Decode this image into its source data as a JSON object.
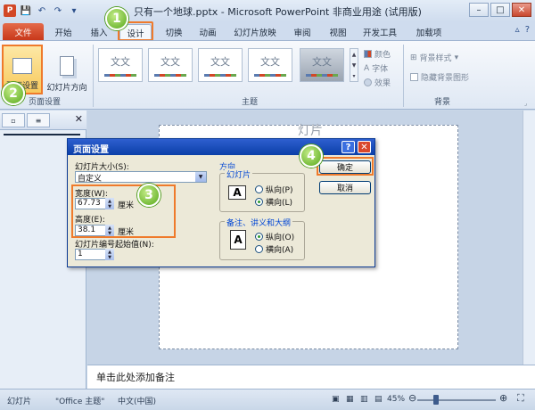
{
  "window": {
    "title": "只有一个地球.pptx - Microsoft PowerPoint 非商业用途 (试用版)",
    "ppt_logo": "P",
    "buttons": {
      "minimize": "–",
      "maximize": "□",
      "close": "✕"
    }
  },
  "tabs": {
    "file": "文件",
    "items": [
      "开始",
      "插入",
      "设计",
      "切换",
      "动画",
      "幻灯片放映",
      "审阅",
      "视图",
      "开发工具",
      "加载项"
    ],
    "active": "设计"
  },
  "ribbon": {
    "page_setup_group": {
      "label": "页面设置",
      "page_setup_button": "页面设置",
      "orientation_button": "幻灯片方向"
    },
    "themes_group": {
      "label": "主题",
      "theme_text": "文文"
    },
    "theme_options": {
      "colors": "颜色",
      "fonts": "字体",
      "effects": "效果"
    },
    "background_group": {
      "label": "背景",
      "background_styles": "背景样式",
      "hide_background": "隐藏背景图形"
    }
  },
  "slide": {
    "placeholder_text": "灯片"
  },
  "notes": {
    "placeholder": "单击此处添加备注"
  },
  "status": {
    "slide_label": "幻灯片",
    "theme": "\"Office 主题\"",
    "language": "中文(中国)",
    "zoom": "45%"
  },
  "dialog": {
    "title": "页面设置",
    "slide_size_label": "幻灯片大小(S):",
    "slide_size_value": "自定义",
    "width_label": "宽度(W):",
    "width_value": "67.73",
    "height_label": "高度(E):",
    "height_value": "38.1",
    "unit": "厘米",
    "start_number_label": "幻灯片编号起始值(N):",
    "start_number_value": "1",
    "orientation_label": "方向",
    "slides_section": "幻灯片",
    "slides_portrait": "纵向(P)",
    "slides_landscape": "横向(L)",
    "notes_section": "备注、讲义和大纲",
    "notes_portrait": "纵向(O)",
    "notes_landscape": "横向(A)",
    "ok": "确定",
    "cancel": "取消",
    "help": "?",
    "close": "✕",
    "page_glyph": "A"
  },
  "steps": [
    "1",
    "2",
    "3",
    "4"
  ]
}
